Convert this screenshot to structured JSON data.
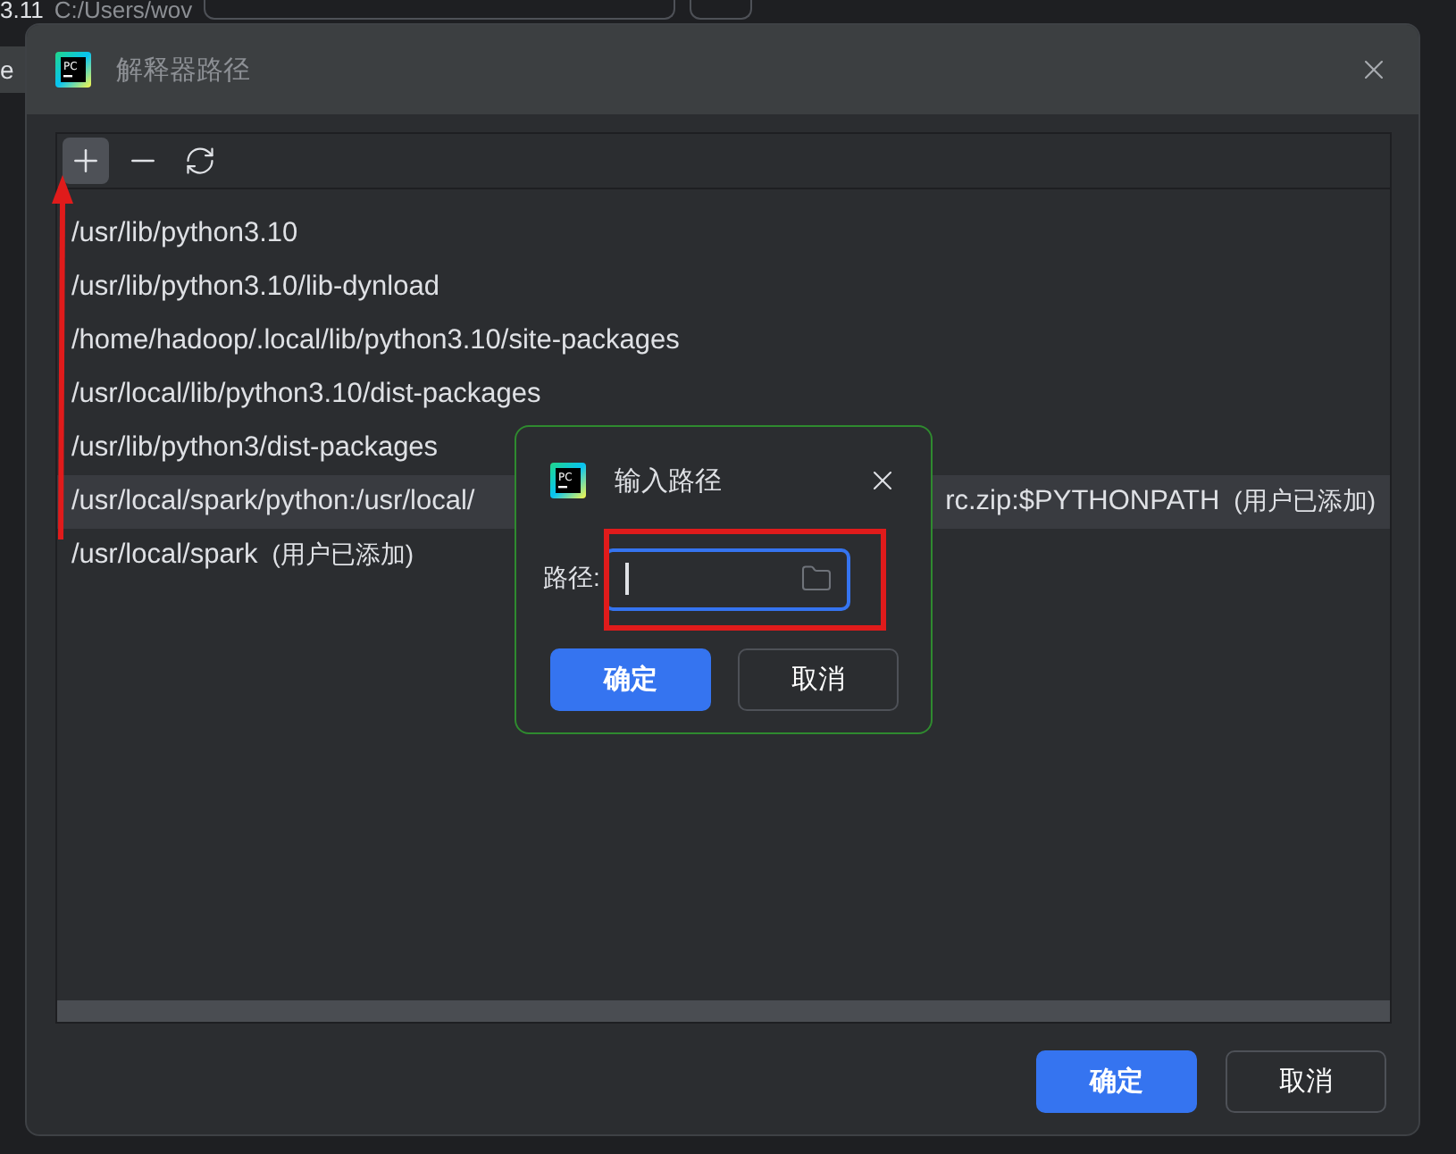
{
  "background": {
    "version": "3.11",
    "path": "C:/Users/wov",
    "side_label": "e"
  },
  "dialog": {
    "logo_text": "PC",
    "title": "解释器路径",
    "toolbar": [
      {
        "kind": "add",
        "selected": true
      },
      {
        "kind": "remove",
        "selected": false
      },
      {
        "kind": "refresh",
        "selected": false
      }
    ],
    "paths": [
      {
        "text": "/usr/lib/python3.10",
        "selected": false
      },
      {
        "text": "/usr/lib/python3.10/lib-dynload",
        "selected": false
      },
      {
        "text": "/home/hadoop/.local/lib/python3.10/site-packages",
        "selected": false
      },
      {
        "text": "/usr/local/lib/python3.10/dist-packages",
        "selected": false
      },
      {
        "text": "/usr/lib/python3/dist-packages",
        "selected": false
      },
      {
        "text": "/usr/local/spark/python:/usr/local/",
        "text_after": "rc.zip:$PYTHONPATH",
        "note": "(用户已添加)",
        "selected": true
      },
      {
        "text": "/usr/local/spark",
        "note": "(用户已添加)",
        "selected": false
      }
    ],
    "buttons": [
      {
        "label": "确定",
        "kind": "primary"
      },
      {
        "label": "取消",
        "kind": "secondary"
      }
    ]
  },
  "input_dialog": {
    "logo_text": "PC",
    "title": "输入路径",
    "field_label": "路径:",
    "buttons": [
      {
        "label": "确定",
        "kind": "primary"
      },
      {
        "label": "取消",
        "kind": "secondary"
      }
    ]
  }
}
